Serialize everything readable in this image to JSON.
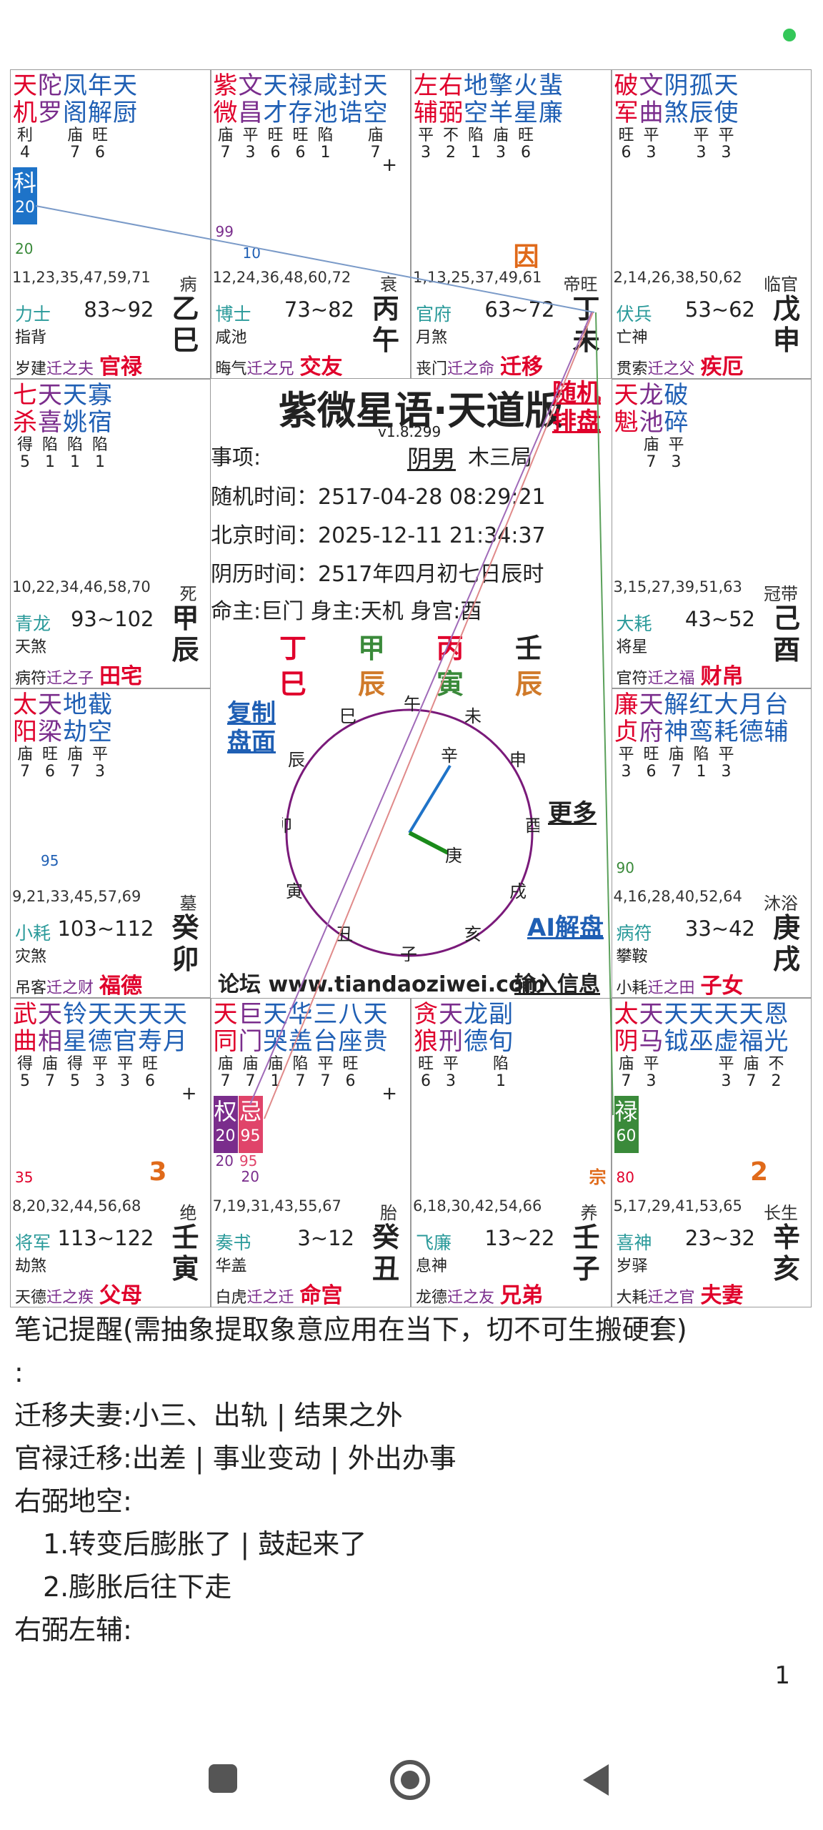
{
  "app": {
    "title": "紫微星语·天道版",
    "version": "v1.8.299"
  },
  "center": {
    "random_paipan": [
      "随机",
      "排盘"
    ],
    "item_label": "事项:",
    "gender": "阴男",
    "bureau": "木三局",
    "random_time": "随机时间：2517-04-28 08:29:21",
    "beijing_time": "北京时间：2025-12-11 21:34:37",
    "lunar_time": "阴历时间：2517年四月初七日辰时",
    "ming_zhu": "命主:巨门 身主:天机 身宫:酉",
    "pillars_top": [
      "丁",
      "甲",
      "丙",
      "壬"
    ],
    "pillars_bottom": [
      "巳",
      "辰",
      "寅",
      "辰"
    ],
    "copy_label": [
      "复制",
      "盘面"
    ],
    "more_label": "更多",
    "ai_label": "AI解盘",
    "forum": "论坛 www.tiandaoziwei.com",
    "input_info": "输入信息",
    "compass": [
      "午",
      "未",
      "申",
      "酉",
      "戌",
      "亥",
      "子",
      "丑",
      "寅",
      "卯",
      "辰",
      "巳"
    ],
    "hand_labels": [
      "辛",
      "庚"
    ]
  },
  "cells": [
    {
      "id": "si",
      "stars": [
        [
          "天",
          "机"
        ],
        [
          "陀",
          "罗"
        ],
        [
          "凤",
          "阁"
        ],
        [
          "年",
          "解"
        ],
        [
          "天",
          "厨"
        ]
      ],
      "brightness": [
        "利\n4",
        "",
        "庙\n7",
        "旺\n6",
        ""
      ],
      "sihua": {
        "label": "科",
        "num": "20",
        "col": "#1e73c8",
        "pos": 0
      },
      "num_a": "20",
      "num_b": "",
      "ages": "11,23,35,47,59,71",
      "cs": "病",
      "god": "力士",
      "luck": "83~92",
      "star2": "指背",
      "bot_pre": "岁建",
      "bot_mid": "迁之夫",
      "palace": "官禄",
      "gz": [
        "乙",
        "巳"
      ]
    },
    {
      "id": "wu",
      "stars": [
        [
          "紫",
          "微"
        ],
        [
          "文",
          "昌"
        ],
        [
          "天",
          "才"
        ],
        [
          "禄",
          "存"
        ],
        [
          "咸",
          "池"
        ],
        [
          "封",
          "诰"
        ],
        [
          "天",
          "空"
        ]
      ],
      "brightness": [
        "庙\n7",
        "平\n3",
        "旺\n6",
        "旺\n6",
        "陷\n1",
        "",
        "庙\n7"
      ],
      "plus": "+",
      "num_a": "99",
      "num_a2": "10",
      "ages": "12,24,36,48,60,72",
      "cs": "衰",
      "god": "博士",
      "luck": "73~82",
      "star2": "咸池",
      "bot_pre": "晦气",
      "bot_mid": "迁之兄",
      "palace": "交友",
      "gz": [
        "丙",
        "午"
      ]
    },
    {
      "id": "wei",
      "stars": [
        [
          "左",
          "辅"
        ],
        [
          "右",
          "弼"
        ],
        [
          "地",
          "空"
        ],
        [
          "擎",
          "羊"
        ],
        [
          "火",
          "星"
        ],
        [
          "蜚",
          "廉"
        ]
      ],
      "brightness": [
        "平\n3",
        "不\n2",
        "陷\n1",
        "庙\n3",
        "旺\n6",
        ""
      ],
      "yin": "因",
      "ages": "1,13,25,37,49,61",
      "cs": "帝旺",
      "god": "官府",
      "luck": "63~72",
      "star2": "月煞",
      "bot_pre": "丧门",
      "bot_mid": "迁之命",
      "palace": "迁移",
      "gz": [
        "丁",
        "未"
      ]
    },
    {
      "id": "shen",
      "stars": [
        [
          "破",
          "军"
        ],
        [
          "文",
          "曲"
        ],
        [
          "阴",
          "煞"
        ],
        [
          "孤",
          "辰"
        ],
        [
          "天",
          "使"
        ]
      ],
      "brightness": [
        "旺\n6",
        "平\n3",
        "",
        "平\n3",
        "平\n3"
      ],
      "ages": "2,14,26,38,50,62",
      "cs": "临官",
      "god": "伏兵",
      "luck": "53~62",
      "star2": "亡神",
      "bot_pre": "贯索",
      "bot_mid": "迁之父",
      "palace": "疾厄",
      "gz": [
        "戊",
        "申"
      ]
    },
    {
      "id": "chen",
      "stars": [
        [
          "七",
          "杀"
        ],
        [
          "天",
          "喜"
        ],
        [
          "天",
          "姚"
        ],
        [
          "寡",
          "宿"
        ]
      ],
      "brightness": [
        "得\n5",
        "陷\n1",
        "陷\n1",
        "陷\n1"
      ],
      "ages": "10,22,34,46,58,70",
      "cs": "死",
      "god": "青龙",
      "luck": "93~102",
      "star2": "天煞",
      "bot_pre": "病符",
      "bot_mid": "迁之子",
      "palace": "田宅",
      "gz": [
        "甲",
        "辰"
      ]
    },
    {
      "id": "you",
      "stars": [
        [
          "天",
          "魁"
        ],
        [
          "龙",
          "池"
        ],
        [
          "破",
          "碎"
        ]
      ],
      "brightness": [
        "",
        "庙\n7",
        "平\n3"
      ],
      "ages": "3,15,27,39,51,63",
      "cs": "冠带",
      "god": "大耗",
      "luck": "43~52",
      "star2": "将星",
      "bot_pre": "官符",
      "bot_mid": "迁之福",
      "palace": "财帛",
      "gz": [
        "己",
        "酉"
      ]
    },
    {
      "id": "mao",
      "stars": [
        [
          "太",
          "阳"
        ],
        [
          "天",
          "梁"
        ],
        [
          "地",
          "劫"
        ],
        [
          "截",
          "空"
        ]
      ],
      "brightness": [
        "庙\n7",
        "旺\n6",
        "庙\n7",
        "平\n3"
      ],
      "num_a2": "95",
      "ages": "9,21,33,45,57,69",
      "cs": "墓",
      "god": "小耗",
      "luck": "103~112",
      "star2": "灾煞",
      "bot_pre": "吊客",
      "bot_mid": "迁之财",
      "palace": "福德",
      "gz": [
        "癸",
        "卯"
      ]
    },
    {
      "id": "xu",
      "stars": [
        [
          "廉",
          "贞"
        ],
        [
          "天",
          "府"
        ],
        [
          "解",
          "神"
        ],
        [
          "红",
          "鸾"
        ],
        [
          "大",
          "耗"
        ],
        [
          "月",
          "德"
        ],
        [
          "台",
          "辅"
        ]
      ],
      "brightness": [
        "平\n3",
        "旺\n6",
        "庙\n7",
        "陷\n1",
        "平\n3",
        "",
        ""
      ],
      "num_a": "90",
      "ages": "4,16,28,40,52,64",
      "cs": "沐浴",
      "god": "病符",
      "luck": "33~42",
      "star2": "攀鞍",
      "bot_pre": "小耗",
      "bot_mid": "迁之田",
      "palace": "子女",
      "gz": [
        "庚",
        "戌"
      ]
    },
    {
      "id": "yin",
      "stars": [
        [
          "武",
          "曲"
        ],
        [
          "天",
          "相"
        ],
        [
          "铃",
          "星"
        ],
        [
          "天",
          "德"
        ],
        [
          "天",
          "官"
        ],
        [
          "天",
          "寿"
        ],
        [
          "天",
          "月"
        ]
      ],
      "brightness": [
        "得\n5",
        "庙\n7",
        "得\n5",
        "平\n3",
        "平\n3",
        "旺\n6",
        ""
      ],
      "plus": "+",
      "num_a": "35",
      "num_c": "3",
      "ages": "8,20,32,44,56,68",
      "cs": "绝",
      "god": "将军",
      "luck": "113~122",
      "star2": "劫煞",
      "bot_pre": "天德",
      "bot_mid": "迁之疾",
      "palace": "父母",
      "gz": [
        "壬",
        "寅"
      ]
    },
    {
      "id": "chou",
      "stars": [
        [
          "天",
          "同"
        ],
        [
          "巨",
          "门"
        ],
        [
          "天",
          "哭"
        ],
        [
          "华",
          "盖"
        ],
        [
          "三",
          "台"
        ],
        [
          "八",
          "座"
        ],
        [
          "天",
          "贵"
        ]
      ],
      "brightness": [
        "庙\n7",
        "庙\n7",
        "庙\n1",
        "陷\n7",
        "平\n7",
        "旺\n6",
        ""
      ],
      "plus": "+",
      "sihua2": [
        {
          "label": "权",
          "num": "20",
          "col": "#7a2d8c",
          "pos": 0
        },
        {
          "label": "忌",
          "num": "95",
          "col": "#e0446a",
          "pos": 1
        }
      ],
      "ages": "7,19,31,43,55,67",
      "cs": "胎",
      "god": "奏书",
      "luck": "3~12",
      "star2": "华盖",
      "bot_pre": "白虎",
      "bot_mid": "迁之迁",
      "palace": "命宫",
      "gz": [
        "癸",
        "丑"
      ]
    },
    {
      "id": "zi",
      "stars": [
        [
          "贪",
          "狼"
        ],
        [
          "天",
          "刑"
        ],
        [
          "龙",
          "德"
        ],
        [
          "副",
          "旬"
        ]
      ],
      "brightness": [
        "旺\n6",
        "平\n3",
        "",
        "陷\n1"
      ],
      "zong": "宗",
      "ages": "6,18,30,42,54,66",
      "cs": "养",
      "god": "飞廉",
      "luck": "13~22",
      "star2": "息神",
      "bot_pre": "龙德",
      "bot_mid": "迁之友",
      "palace": "兄弟",
      "gz": [
        "壬",
        "子"
      ]
    },
    {
      "id": "hai",
      "stars": [
        [
          "太",
          "阴"
        ],
        [
          "天",
          "马"
        ],
        [
          "天",
          "钺"
        ],
        [
          "天",
          "巫"
        ],
        [
          "天",
          "虚"
        ],
        [
          "天",
          "福"
        ],
        [
          "恩",
          "光"
        ]
      ],
      "brightness": [
        "庙\n7",
        "平\n3",
        "",
        "",
        "平\n3",
        "庙\n7",
        "不\n2"
      ],
      "sihua": {
        "label": "禄",
        "num": "60",
        "col": "#3a8a3a",
        "pos": 0
      },
      "num_a": "80",
      "num_c": "2",
      "ages": "5,17,29,41,53,65",
      "cs": "长生",
      "god": "喜神",
      "luck": "23~32",
      "star2": "岁驿",
      "bot_pre": "大耗",
      "bot_mid": "迁之官",
      "palace": "夫妻",
      "gz": [
        "辛",
        "亥"
      ]
    }
  ],
  "notes": {
    "line1": "笔记提醒(需抽象提取象意应用在当下，切不可生搬硬套)",
    "line2": ":",
    "line3": "迁移夫妻:小三、出轨 | 结果之外",
    "line4": "官禄迁移:出差 | 事业变动 | 外出办事",
    "line5": "右弼地空:",
    "line6": "1.转变后膨胀了 | 鼓起来了",
    "line7": "2.膨胀后往下走",
    "line8": "右弼左辅:"
  },
  "page_num": "1",
  "nav": {
    "recent": "square-icon",
    "home": "circle-icon",
    "back": "triangle-icon"
  },
  "colors": {
    "red": "#e0002b",
    "blue": "#1f5fb4",
    "purple": "#7a2d8c",
    "teal": "#2a9a9a",
    "green": "#3a8a3a"
  }
}
